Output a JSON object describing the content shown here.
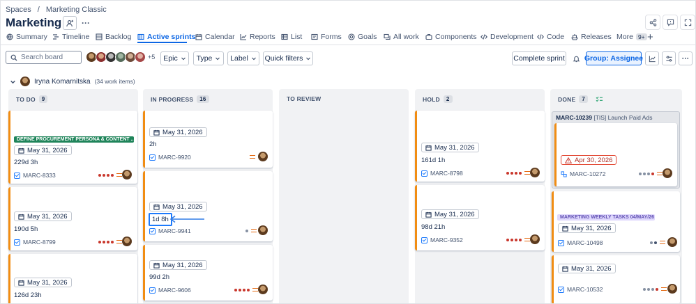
{
  "breadcrumb": {
    "root": "Spaces",
    "sep": "/",
    "current": "Marketing Classic"
  },
  "space_title": "Marketing",
  "tabs": [
    {
      "label": "Summary",
      "icon": "globe-icon"
    },
    {
      "label": "Timeline",
      "icon": "timeline-icon"
    },
    {
      "label": "Backlog",
      "icon": "backlog-icon"
    },
    {
      "label": "Active sprints",
      "icon": "board-icon",
      "active": true
    },
    {
      "label": "Calendar",
      "icon": "calendar-icon"
    },
    {
      "label": "Reports",
      "icon": "chart-icon"
    },
    {
      "label": "List",
      "icon": "list-icon"
    },
    {
      "label": "Forms",
      "icon": "form-icon"
    },
    {
      "label": "Goals",
      "icon": "goal-icon"
    },
    {
      "label": "All work",
      "icon": "stack-icon"
    },
    {
      "label": "Components",
      "icon": "component-icon"
    },
    {
      "label": "Development",
      "icon": "code-icon"
    },
    {
      "label": "Code",
      "icon": "code-icon"
    },
    {
      "label": "Releases",
      "icon": "ship-icon"
    },
    {
      "label": "More",
      "badge": "9+"
    }
  ],
  "toolbar": {
    "search_placeholder": "Search board",
    "avatars_more": "+5",
    "filters": [
      "Epic",
      "Type",
      "Label",
      "Quick filters"
    ],
    "complete_sprint": "Complete sprint",
    "group_by": "Group: Assignee"
  },
  "swimlane": {
    "assignee": "Iryna Komarnitska",
    "count_text": "(34 work items)"
  },
  "columns": [
    {
      "name": "TO DO",
      "count": "9"
    },
    {
      "name": "IN PROGRESS",
      "count": "16"
    },
    {
      "name": "TO REVIEW",
      "count": ""
    },
    {
      "name": "HOLD",
      "count": "2"
    },
    {
      "name": "DONE",
      "count": "7"
    }
  ],
  "cards": {
    "todo": [
      {
        "label": "DEFINE PROCUREMENT PERSONA & CONTENT ...",
        "date": "May 31, 2026",
        "estimate": "229d 3h",
        "key": "MARC-8333",
        "priority": "highest"
      },
      {
        "date": "May 31, 2026",
        "estimate": "190d 5h",
        "key": "MARC-8799",
        "priority": "highest"
      },
      {
        "date": "May 31, 2026",
        "estimate": "126d 23h"
      }
    ],
    "inprogress": [
      {
        "date": "May 31, 2026",
        "estimate": "2h",
        "key": "MARC-9920",
        "priority": "medium"
      },
      {
        "date": "May 31, 2026",
        "estimate": "1d 8h",
        "key": "MARC-9941",
        "priority": "low"
      },
      {
        "date": "May 31, 2026",
        "estimate": "99d 2h",
        "key": "MARC-9606",
        "priority": "highest"
      }
    ],
    "hold": [
      {
        "date": "May 31, 2026",
        "estimate": "161d 1h",
        "key": "MARC-8798",
        "priority": "highest"
      },
      {
        "date": "May 31, 2026",
        "estimate": "98d 21h",
        "key": "MARC-9352",
        "priority": "highest"
      }
    ],
    "done": [
      {
        "parent": "MARC-10239",
        "parent_title": "[TIS] Launch Paid Ads",
        "date": "Apr 30, 2026",
        "key": "MARC-10272",
        "priority": "highest-gray"
      },
      {
        "label": "MARKETING WEEKLY TASKS 04/MAY/26",
        "date": "May 31, 2026",
        "key": "MARC-10498",
        "priority": "low-gray"
      },
      {
        "date": "May 31, 2026",
        "key": "MARC-10532",
        "priority": "highest-gray"
      }
    ]
  },
  "colors": {
    "accent": "#0c66e4",
    "in_progress_bar": "#f18d13",
    "label_green": "#1f845a",
    "label_purple": "#e9d5ff",
    "overdue": "#e34935"
  }
}
